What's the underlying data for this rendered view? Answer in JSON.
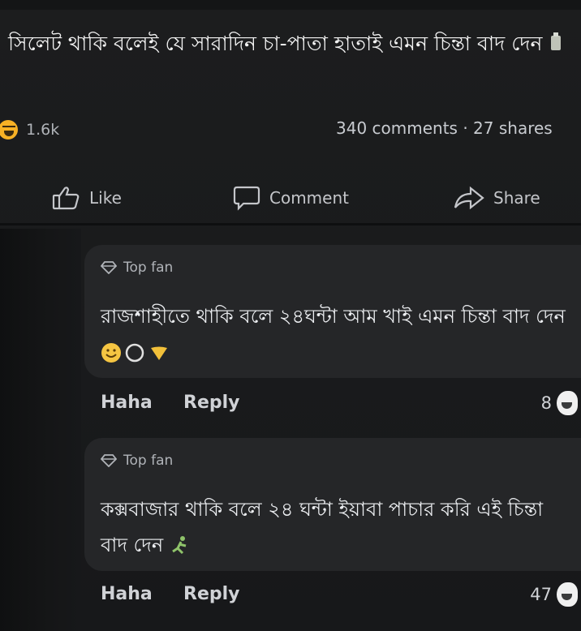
{
  "post": {
    "text": "সিলেট থাকি বলেই যে সারাদিন চা-পাতা হাতাই এমন চিন্তা বাদ দেন",
    "reaction_count": "1.6k",
    "counts_text": "340 comments · 27 shares"
  },
  "actions": {
    "like_label": "Like",
    "comment_label": "Comment",
    "share_label": "Share"
  },
  "comments": [
    {
      "badge": "Top fan",
      "text": "রাজশাহীতে থাকি বলে ২৪ঘন্টা আম খাই এমন চিন্তা বাদ দেন",
      "haha_label": "Haha",
      "reply_label": "Reply",
      "reaction_count": "8"
    },
    {
      "badge": "Top fan",
      "text": "কক্সবাজার থাকি বলে ২৪ ঘন্টা ইয়াবা পাচার করি এই চিন্তা বাদ দেন",
      "haha_label": "Haha",
      "reply_label": "Reply",
      "reaction_count": "47"
    }
  ],
  "colors": {
    "background": "#18191a",
    "bubble": "#252628",
    "haha": "#f7b125"
  },
  "icons": [
    "haha-reaction-icon",
    "like-icon",
    "comment-icon",
    "share-icon",
    "diamond-icon"
  ]
}
